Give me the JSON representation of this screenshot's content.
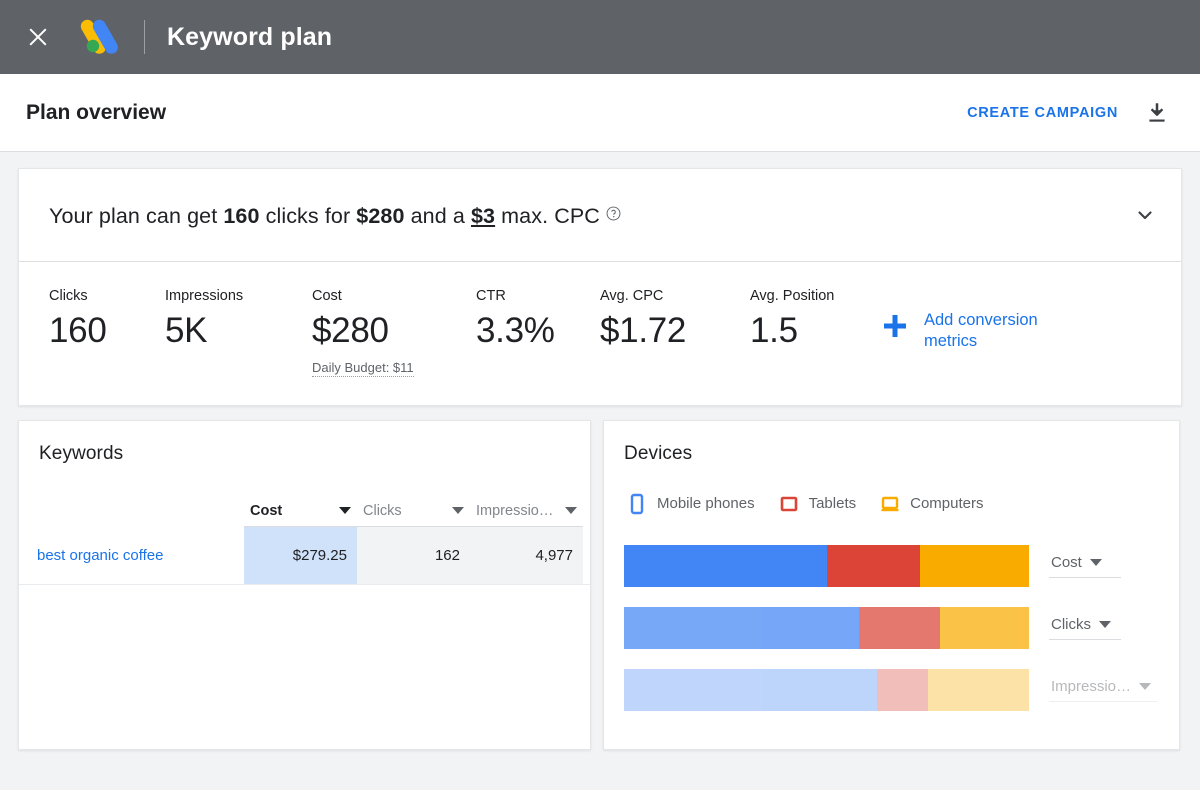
{
  "topbar": {
    "close_icon": "close-icon",
    "logo_icon": "google-ads-logo",
    "title": "Keyword plan"
  },
  "subheader": {
    "title": "Plan overview",
    "create_campaign_label": "CREATE CAMPAIGN",
    "download_icon": "download-icon"
  },
  "summary": {
    "prefix": "Your plan can get ",
    "clicks": "160",
    "mid1": " clicks for ",
    "cost": "$280",
    "mid2": " and a ",
    "max_cpc": "$3",
    "suffix": " max. CPC",
    "help_icon": "help-icon",
    "expand_icon": "chevron-down-icon"
  },
  "metrics": [
    {
      "label": "Clicks",
      "value": "160",
      "sub": ""
    },
    {
      "label": "Impressions",
      "value": "5K",
      "sub": ""
    },
    {
      "label": "Cost",
      "value": "$280",
      "sub": "Daily Budget: $11"
    },
    {
      "label": "CTR",
      "value": "3.3%",
      "sub": ""
    },
    {
      "label": "Avg. CPC",
      "value": "$1.72",
      "sub": ""
    },
    {
      "label": "Avg. Position",
      "value": "1.5",
      "sub": ""
    }
  ],
  "add_conversion": {
    "icon": "plus-icon",
    "label": "Add conversion metrics"
  },
  "keywords_panel": {
    "title": "Keywords",
    "columns": [
      {
        "label": "Cost",
        "active": true
      },
      {
        "label": "Clicks",
        "active": false
      },
      {
        "label": "Impressio…",
        "active": false
      }
    ],
    "rows": [
      {
        "keyword": "best organic coffee",
        "cost": "$279.25",
        "clicks": "162",
        "impressions": "4,977"
      }
    ]
  },
  "devices_panel": {
    "title": "Devices",
    "legend": [
      {
        "label": "Mobile phones",
        "icon": "mobile-phone-icon",
        "color": "#4285f4"
      },
      {
        "label": "Tablets",
        "icon": "tablet-icon",
        "color": "#db4437"
      },
      {
        "label": "Computers",
        "icon": "computer-icon",
        "color": "#f9ab00"
      }
    ],
    "rows": [
      {
        "label": "Cost",
        "opacity": 1,
        "faded": false
      },
      {
        "label": "Clicks",
        "opacity": 0.72,
        "faded": false
      },
      {
        "label": "Impressio…",
        "opacity": 0.34,
        "faded": true
      }
    ]
  },
  "colors": {
    "brand_blue": "#1a73e8",
    "mobile": "#4285f4",
    "tablet": "#db4437",
    "computer": "#f9ab00",
    "topbar_bg": "#5f6368",
    "page_bg": "#f1f3f4",
    "highlight_cell": "#cfe2f9"
  },
  "chart_data": {
    "type": "bar",
    "title": "Devices",
    "orientation": "horizontal",
    "stacked": true,
    "categories": [
      "Cost",
      "Clicks",
      "Impressio…"
    ],
    "series": [
      {
        "name": "Mobile phones",
        "color": "#4285f4",
        "values": [
          50.0,
          58.0,
          62.5
        ]
      },
      {
        "name": "Tablets",
        "color": "#db4437",
        "values": [
          23.0,
          20.0,
          12.5
        ]
      },
      {
        "name": "Computers",
        "color": "#f9ab00",
        "values": [
          27.0,
          22.0,
          25.0
        ]
      }
    ],
    "unit": "percent of total",
    "legend_position": "top",
    "grid": false,
    "axis_labels_shown": false
  }
}
